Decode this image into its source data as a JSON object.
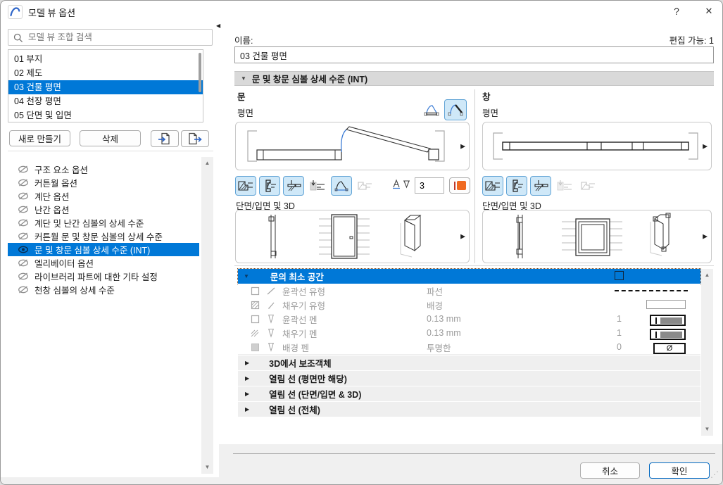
{
  "window": {
    "title": "모델 뷰 옵션",
    "help_glyph": "?",
    "close_glyph": "✕",
    "app_icon": "archicad-arc-icon",
    "accent_color": "#0078d7"
  },
  "left": {
    "search_placeholder": "모델 뷰 조합 검색",
    "combinations": [
      {
        "label": "01 부지",
        "selected": false
      },
      {
        "label": "02 제도",
        "selected": false
      },
      {
        "label": "03 건물 평면",
        "selected": true
      },
      {
        "label": "04 천장 평면",
        "selected": false
      },
      {
        "label": "05 단면 및 입면",
        "selected": false
      }
    ],
    "new_button": "새로 만들기",
    "delete_button": "삭제",
    "import_button_icon": "import-page-icon",
    "export_button_icon": "export-page-icon",
    "options": [
      {
        "label": "구조 요소 옵션",
        "eye": "off"
      },
      {
        "label": "커튼월 옵션",
        "eye": "off"
      },
      {
        "label": "계단 옵션",
        "eye": "off"
      },
      {
        "label": "난간 옵션",
        "eye": "off"
      },
      {
        "label": "계단 및 난간 심볼의 상세 수준",
        "eye": "off"
      },
      {
        "label": "커튼월 문 및 창문 심볼의 상세 수준",
        "eye": "off"
      },
      {
        "label": "문 및 창문 심볼 상세 수준 (INT)",
        "eye": "on",
        "selected": true
      },
      {
        "label": "엘리베이터 옵션",
        "eye": "off"
      },
      {
        "label": "라이브러리 파트에 대한 기타 설정",
        "eye": "off"
      },
      {
        "label": "천창 심볼의 상세 수준",
        "eye": "off"
      }
    ]
  },
  "right": {
    "name_label": "이름:",
    "editable_label": "편집 가능: 1",
    "name_value": "03 건물 평면",
    "section_header": "문 및 창문 심볼 상세 수준 (INT)",
    "door": {
      "title": "문",
      "plan_label": "평면",
      "section_label": "단면/입면 및 3D",
      "open_style_toggles": [
        {
          "name": "door-closed-symbol",
          "state": "off"
        },
        {
          "name": "door-open-symbol",
          "state": "on"
        }
      ],
      "symbol_buttons": [
        {
          "name": "wall-opening-hatch",
          "state": "on"
        },
        {
          "name": "frame-hatch",
          "state": "on"
        },
        {
          "name": "sill-hatch",
          "state": "on"
        },
        {
          "name": "marker-lines",
          "state": "off"
        },
        {
          "name": "opening-arc",
          "state": "on"
        },
        {
          "name": "opening-lines",
          "state": "disabled"
        }
      ],
      "pen_number": "3",
      "pen_color": "#f06a21"
    },
    "window_col": {
      "title": "창",
      "plan_label": "평면",
      "section_label": "단면/입면 및 3D",
      "symbol_buttons": [
        {
          "name": "wall-opening-hatch",
          "state": "on"
        },
        {
          "name": "frame-hatch",
          "state": "on"
        },
        {
          "name": "sill-hatch",
          "state": "on"
        },
        {
          "name": "marker-lines",
          "state": "disabled"
        },
        {
          "name": "opening-lines",
          "state": "disabled"
        }
      ]
    },
    "table": {
      "header": "문의 최소 공간",
      "header_checked": false,
      "rows": [
        {
          "label": "윤곽선 유형",
          "value": "파선",
          "pen": "",
          "preview": "dashed-line"
        },
        {
          "label": "채우기 유형",
          "value": "배경",
          "pen": "",
          "preview": "white-rect"
        },
        {
          "label": "윤곽선 펜",
          "value": "0.13 mm",
          "pen": "1",
          "preview": "pen-swatch"
        },
        {
          "label": "채우기 펜",
          "value": "0.13 mm",
          "pen": "1",
          "preview": "pen-swatch"
        },
        {
          "label": "배경 펜",
          "value": "투명한",
          "pen": "0",
          "preview": "empty-set"
        }
      ],
      "empty_set_glyph": "Ø",
      "groups": [
        {
          "label": "3D에서 보조객체"
        },
        {
          "label": "열림 선 (평면만 해당)"
        },
        {
          "label": "열림 선 (단면/입면 & 3D)"
        },
        {
          "label": "열림 선 (전체)"
        }
      ]
    },
    "cancel_button": "취소",
    "ok_button": "확인"
  },
  "glyphs": {
    "collapse_down": "▼",
    "expand_right": "▶",
    "fly_right": "▶",
    "splitter_left": "◀",
    "scroll_up": "▲",
    "scroll_down": "▼",
    "resize_grip": "⋰"
  }
}
